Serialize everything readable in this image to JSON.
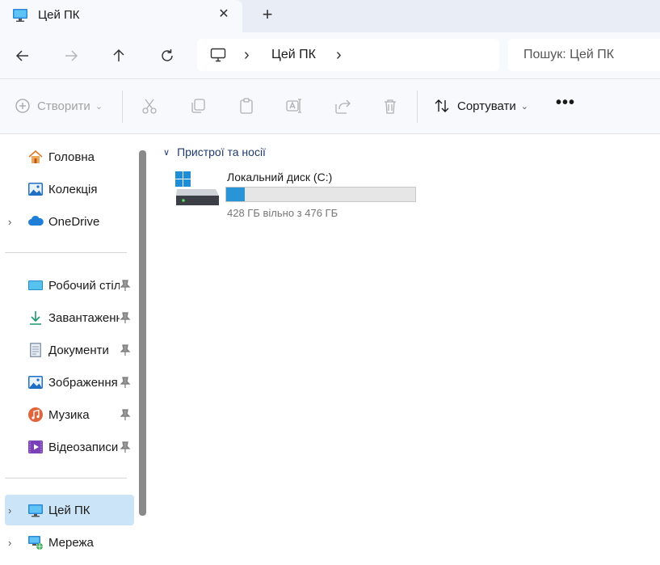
{
  "tab": {
    "title": "Цей ПК",
    "close_icon": "close-icon",
    "new_tab_icon": "plus-icon"
  },
  "address": {
    "crumb": "Цей ПК",
    "separator": "›"
  },
  "search": {
    "placeholder": "Пошук: Цей ПК"
  },
  "commands": {
    "new_label": "Створити",
    "sort_label": "Сортувати",
    "more": "•••"
  },
  "sidebar": {
    "items": [
      {
        "label": "Головна",
        "icon": "home-icon"
      },
      {
        "label": "Колекція",
        "icon": "gallery-icon"
      },
      {
        "label": "OneDrive",
        "icon": "cloud-icon"
      },
      {
        "label": "Робочий стіл",
        "icon": "desktop-folder-icon"
      },
      {
        "label": "Завантаження",
        "icon": "download-icon"
      },
      {
        "label": "Документи",
        "icon": "documents-icon"
      },
      {
        "label": "Зображення",
        "icon": "pictures-icon"
      },
      {
        "label": "Музика",
        "icon": "music-icon"
      },
      {
        "label": "Відеозаписи",
        "icon": "videos-icon"
      },
      {
        "label": "Цей ПК",
        "icon": "pc-icon"
      },
      {
        "label": "Мережа",
        "icon": "network-icon"
      }
    ]
  },
  "content": {
    "group_label": "Пристрої та носії",
    "drive": {
      "name": "Локальний диск (C:)",
      "free_text": "428 ГБ вільно з 476 ГБ",
      "used_fraction": 0.1,
      "bar_color": "#2a95d6"
    }
  }
}
